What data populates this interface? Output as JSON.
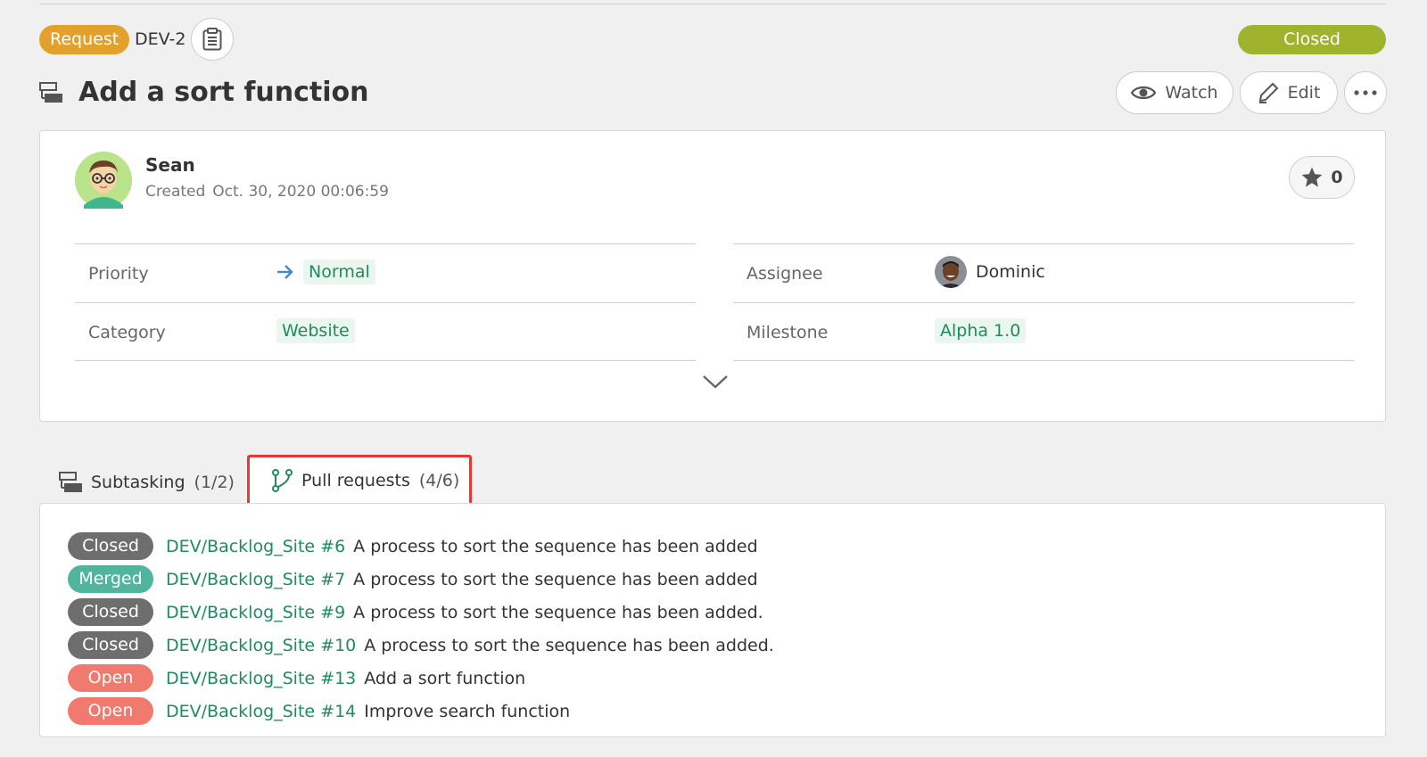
{
  "header": {
    "type_label": "Request",
    "issue_key": "DEV-2",
    "status": "Closed",
    "colors": {
      "type": "#e2a12b",
      "status": "#a0b32c"
    }
  },
  "title": {
    "text": "Add a sort function",
    "watch_label": "Watch",
    "edit_label": "Edit"
  },
  "details": {
    "author": "Sean",
    "created_label": "Created",
    "created_at": "Oct. 30, 2020 00:06:59",
    "star_count": "0",
    "left_props": [
      {
        "label": "Priority",
        "value": "Normal",
        "icon": "arrow-right-icon"
      },
      {
        "label": "Category",
        "value": "Website"
      }
    ],
    "right_props": [
      {
        "label": "Assignee",
        "value": "Dominic",
        "icon": "avatar"
      },
      {
        "label": "Milestone",
        "value": "Alpha 1.0"
      }
    ]
  },
  "tabs": [
    {
      "label": "Subtasking",
      "count": "(1/2)",
      "icon": "subtask-icon"
    },
    {
      "label": "Pull requests",
      "count": "(4/6)",
      "icon": "pull-request-icon",
      "highlighted": true
    }
  ],
  "pull_requests": [
    {
      "status": "Closed",
      "ref": "DEV/Backlog_Site #6",
      "description": "A process to sort the sequence has been added"
    },
    {
      "status": "Merged",
      "ref": "DEV/Backlog_Site #7",
      "description": "A process to sort the sequence has been added"
    },
    {
      "status": "Closed",
      "ref": "DEV/Backlog_Site #9",
      "description": "A process to sort the sequence has been added."
    },
    {
      "status": "Closed",
      "ref": "DEV/Backlog_Site #10",
      "description": "A process to sort the sequence has been added."
    },
    {
      "status": "Open",
      "ref": "DEV/Backlog_Site #13",
      "description": "Add a sort function"
    },
    {
      "status": "Open",
      "ref": "DEV/Backlog_Site #14",
      "description": "Improve search function"
    }
  ],
  "status_colors": {
    "Closed": "#6e6e6e",
    "Merged": "#4fb59c",
    "Open": "#f07a6e",
    "highlight": "#e53935"
  }
}
